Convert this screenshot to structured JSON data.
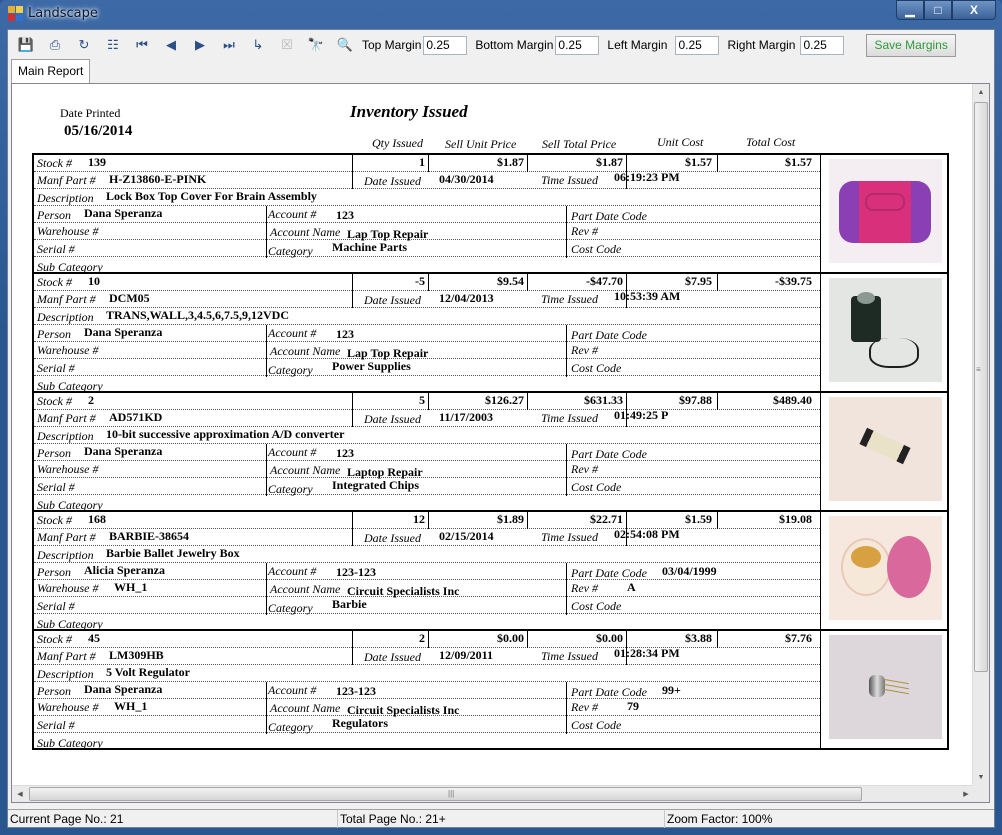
{
  "window": {
    "title": "Landscape",
    "controls": {
      "minimize": "▁",
      "maximize": "□",
      "close": "X"
    }
  },
  "toolbar": {
    "icons": [
      {
        "name": "export-icon",
        "glyph": "💾",
        "enabled": true
      },
      {
        "name": "print-icon",
        "glyph": "⎙",
        "enabled": true
      },
      {
        "name": "refresh-icon",
        "glyph": "↻",
        "enabled": true
      },
      {
        "name": "group-tree-icon",
        "glyph": "☷",
        "enabled": true
      },
      {
        "name": "first-page-icon",
        "glyph": "⏮",
        "enabled": true
      },
      {
        "name": "previous-page-icon",
        "glyph": "◀",
        "enabled": true
      },
      {
        "name": "next-page-icon",
        "glyph": "▶",
        "enabled": true
      },
      {
        "name": "last-page-icon",
        "glyph": "⏭",
        "enabled": true
      },
      {
        "name": "goto-page-icon",
        "glyph": "↳",
        "enabled": true
      },
      {
        "name": "stop-icon",
        "glyph": "☒",
        "enabled": false
      },
      {
        "name": "find-icon",
        "glyph": "🔭",
        "enabled": true
      },
      {
        "name": "zoom-icon",
        "glyph": "🔍",
        "enabled": true
      }
    ],
    "top_margin_label": "Top Margin",
    "top_margin_value": "0.25",
    "bottom_margin_label": "Bottom Margin",
    "bottom_margin_value": "0.25",
    "left_margin_label": "Left Margin",
    "left_margin_value": "0.25",
    "right_margin_label": "Right Margin",
    "right_margin_value": "0.25",
    "save_label": "Save Margins"
  },
  "tabs": [
    {
      "label": "Main Report",
      "active": true
    }
  ],
  "report": {
    "date_printed_label": "Date Printed",
    "date_printed": "05/16/2014",
    "title": "Inventory Issued",
    "columns": [
      "Qty Issued",
      "Sell Unit Price",
      "Sell Total Price",
      "Unit Cost",
      "Total Cost"
    ],
    "labels": {
      "stock": "Stock #",
      "manf_part": "Manf Part #",
      "description": "Description",
      "person": "Person",
      "warehouse": "Warehouse #",
      "serial": "Serial #",
      "sub_category": "Sub Category",
      "account_no": "Account #",
      "account_name": "Account Name",
      "category": "Category",
      "part_date_code": "Part Date Code",
      "rev": "Rev #",
      "cost_code": "Cost Code",
      "date_issued": "Date Issued",
      "time_issued": "Time Issued"
    },
    "records": [
      {
        "stock": "139",
        "qty": "1",
        "sell_unit": "$1.87",
        "sell_total": "$1.87",
        "unit_cost": "$1.57",
        "total_cost": "$1.57",
        "manf_part": "H-Z13860-E-PINK",
        "date_issued": "04/30/2014",
        "time_issued": "06:19:23 PM",
        "description": "Lock Box Top Cover For Brain Assembly",
        "person": "Dana Speranza",
        "account_no": "123",
        "part_date_code": "",
        "warehouse": "",
        "account_name": "Lap Top Repair",
        "rev": "",
        "serial": "",
        "category": "Machine Parts",
        "cost_code": "",
        "sub_category": "",
        "image": "pink-purple-lockbox-cover"
      },
      {
        "stock": "10",
        "qty": "-5",
        "sell_unit": "$9.54",
        "sell_total": "-$47.70",
        "unit_cost": "$7.95",
        "total_cost": "-$39.75",
        "manf_part": "DCM05",
        "date_issued": "12/04/2013",
        "time_issued": "10:53:39 AM",
        "description": "TRANS,WALL,3,4.5,6,7.5,9,12VDC",
        "person": "Dana Speranza",
        "account_no": "123",
        "part_date_code": "",
        "warehouse": "",
        "account_name": "Lap Top Repair",
        "rev": "",
        "serial": "",
        "category": "Power Supplies",
        "cost_code": "",
        "sub_category": "",
        "image": "wall-power-adapter"
      },
      {
        "stock": "2",
        "qty": "5",
        "sell_unit": "$126.27",
        "sell_total": "$631.33",
        "unit_cost": "$97.88",
        "total_cost": "$489.40",
        "manf_part": "AD571KD",
        "date_issued": "11/17/2003",
        "time_issued": "01:49:25 P",
        "description": "10-bit successive approximation A/D converter",
        "person": "Dana Speranza",
        "account_no": "123",
        "part_date_code": "",
        "warehouse": "",
        "account_name": "Laptop Repair",
        "rev": "",
        "serial": "",
        "category": "Integrated Chips",
        "cost_code": "",
        "sub_category": "",
        "image": "dip-integrated-circuit"
      },
      {
        "stock": "168",
        "qty": "12",
        "sell_unit": "$1.89",
        "sell_total": "$22.71",
        "unit_cost": "$1.59",
        "total_cost": "$19.08",
        "manf_part": "BARBIE-38654",
        "date_issued": "02/15/2014",
        "time_issued": "02:54:08 PM",
        "description": "Barbie Ballet Jewelry Box",
        "person": "Alicia Speranza",
        "account_no": "123-123",
        "part_date_code": "03/04/1999",
        "warehouse": "WH_1",
        "account_name": "Circuit Specialists Inc",
        "rev": "A",
        "serial": "",
        "category": "Barbie",
        "cost_code": "",
        "sub_category": "",
        "image": "pink-jewelry-box"
      },
      {
        "stock": "45",
        "qty": "2",
        "sell_unit": "$0.00",
        "sell_total": "$0.00",
        "unit_cost": "$3.88",
        "total_cost": "$7.76",
        "manf_part": "LM309HB",
        "date_issued": "12/09/2011",
        "time_issued": "01:28:34 PM",
        "description": "5 Volt Regulator",
        "person": "Dana Speranza",
        "account_no": "123-123",
        "part_date_code": "99+",
        "warehouse": "WH_1",
        "account_name": "Circuit Specialists Inc",
        "rev": "79",
        "serial": "",
        "category": "Regulators",
        "cost_code": "",
        "sub_category": "",
        "image": "to-can-regulator"
      }
    ]
  },
  "statusbar": {
    "current_page": "Current Page No.: 21",
    "total_pages": "Total Page No.: 21+",
    "zoom": "Zoom Factor: 100%"
  }
}
